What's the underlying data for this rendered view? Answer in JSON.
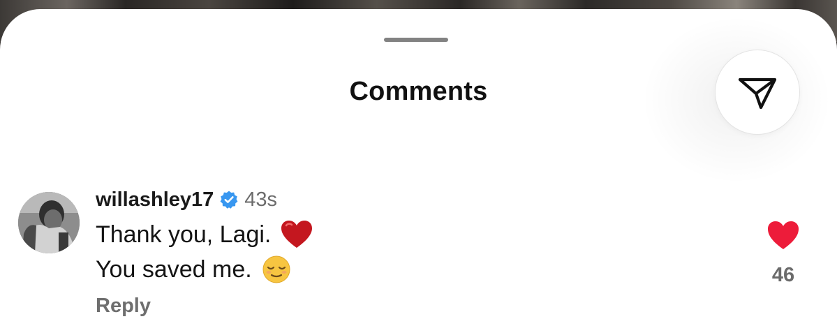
{
  "sheet": {
    "title": "Comments"
  },
  "share_button": {
    "icon": "send-icon"
  },
  "comment": {
    "username": "willashley17",
    "verified": true,
    "timestamp": "43s",
    "line1": "Thank you, Lagi.",
    "line1_emoji": "red-heart-emoji",
    "line2": "You saved me.",
    "line2_emoji": "relieved-face-emoji",
    "reply_label": "Reply",
    "like_count": "46",
    "liked": true
  },
  "colors": {
    "verified_badge": "#3897f0",
    "like_heart": "#ed1c3a",
    "secondary_text": "#6e6e6e",
    "primary_text": "#141414"
  }
}
